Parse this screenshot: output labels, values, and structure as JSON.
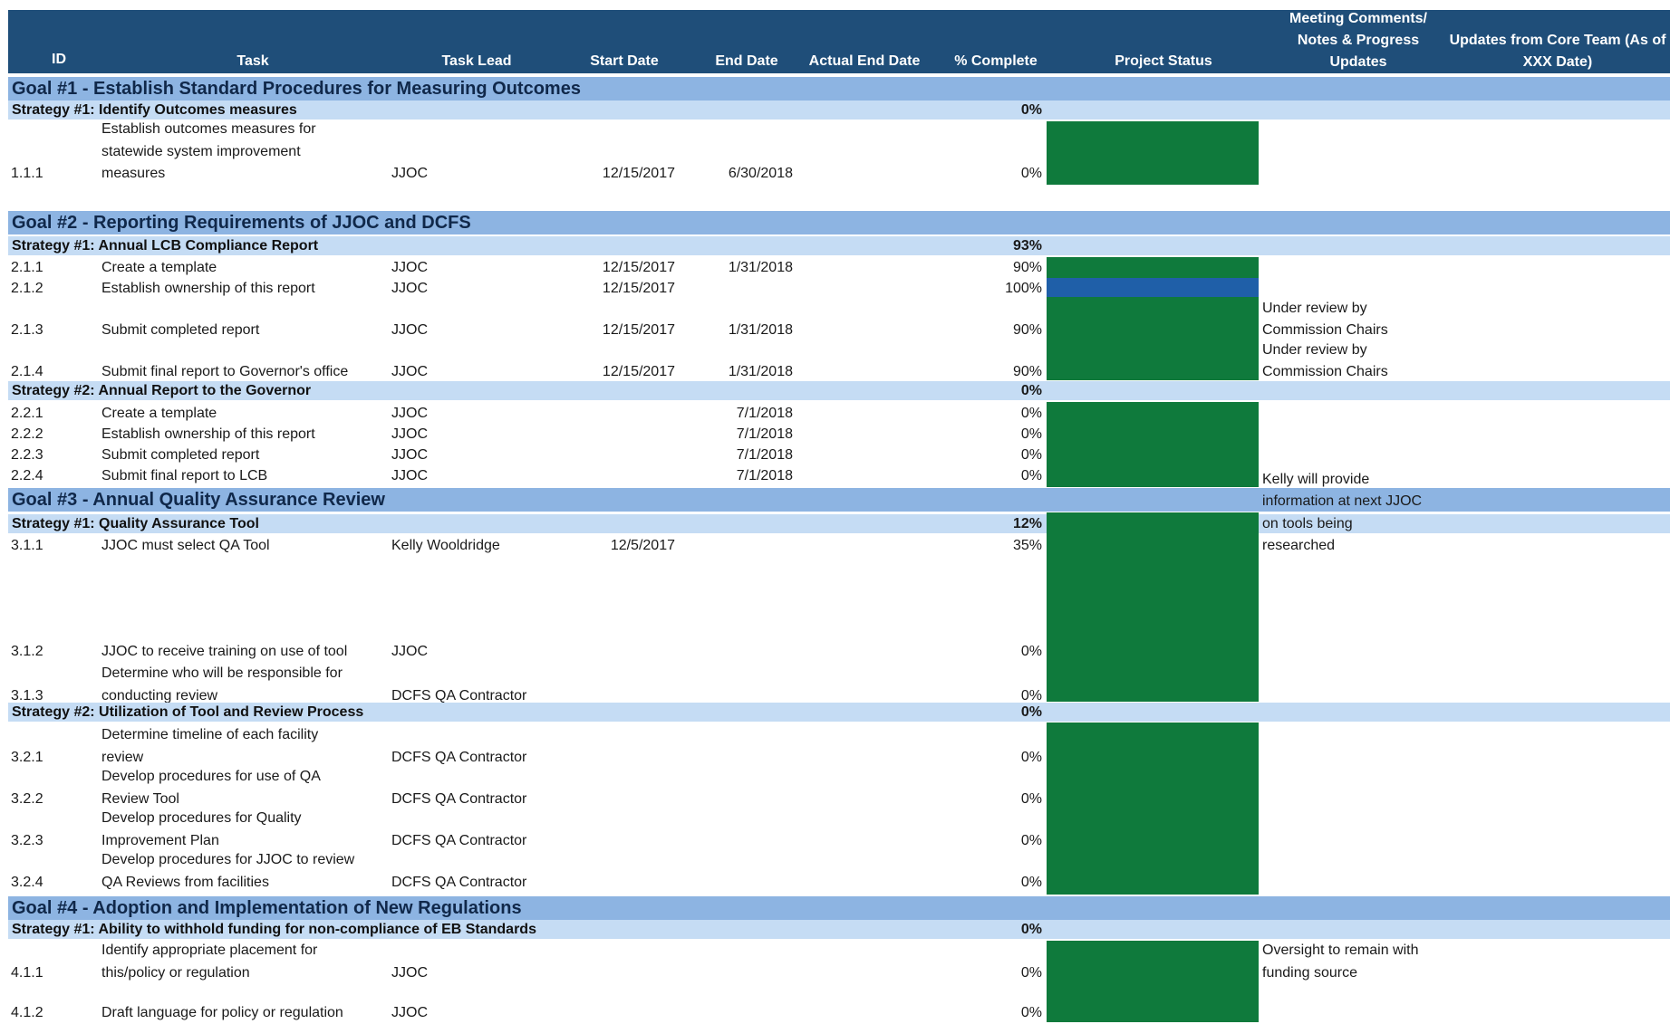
{
  "headers": {
    "id": "ID",
    "task": "Task",
    "task_lead": "Task Lead",
    "start_date": "Start Date",
    "end_date": "End Date",
    "actual_end_date": "Actual End Date",
    "pct_complete": "% Complete",
    "project_status": "Project Status",
    "meeting_comments": [
      "Meeting Comments/",
      "Notes & Progress",
      "Updates"
    ],
    "core_updates": [
      "Updates from Core Team (As of",
      "XXX Date)"
    ]
  },
  "goals": [
    {
      "title": "Goal #1 - Establish Standard Procedures for Measuring Outcomes",
      "strategies": [
        {
          "title": "Strategy #1: Identify Outcomes measures",
          "pct": "0%",
          "tasks": [
            {
              "id": "1.1.1",
              "task": [
                "Establish outcomes measures for",
                "statewide system improvement",
                "measures"
              ],
              "lead": "JJOC",
              "start": "12/15/2017",
              "end": "6/30/2018",
              "pct": "0%",
              "comments": []
            }
          ]
        }
      ]
    },
    {
      "title": "Goal #2 - Reporting Requirements of JJOC and DCFS",
      "strategies": [
        {
          "title": "Strategy #1: Annual LCB Compliance Report",
          "pct": "93%",
          "tasks": [
            {
              "id": "2.1.1",
              "task": [
                "Create a template"
              ],
              "lead": "JJOC",
              "start": "12/15/2017",
              "end": "1/31/2018",
              "pct": "90%",
              "comments": []
            },
            {
              "id": "2.1.2",
              "task": [
                "Establish ownership of this report"
              ],
              "lead": "JJOC",
              "start": "12/15/2017",
              "end": "",
              "pct": "100%",
              "comments": []
            },
            {
              "id": "2.1.3",
              "task": [
                "Submit completed report"
              ],
              "lead": "JJOC",
              "start": "12/15/2017",
              "end": "1/31/2018",
              "pct": "90%",
              "comments": [
                "Under review by",
                "Commission Chairs"
              ]
            },
            {
              "id": "2.1.4",
              "task": [
                "Submit final report to Governor's office"
              ],
              "lead": "JJOC",
              "start": "12/15/2017",
              "end": "1/31/2018",
              "pct": "90%",
              "comments": [
                "Under review by",
                "Commission Chairs"
              ]
            }
          ]
        },
        {
          "title": "Strategy #2: Annual Report to the Governor",
          "pct": "0%",
          "tasks": [
            {
              "id": "2.2.1",
              "task": [
                "Create a template"
              ],
              "lead": "JJOC",
              "start": "",
              "end": "7/1/2018",
              "pct": "0%",
              "comments": []
            },
            {
              "id": "2.2.2",
              "task": [
                "Establish ownership of this report"
              ],
              "lead": "JJOC",
              "start": "",
              "end": "7/1/2018",
              "pct": "0%",
              "comments": []
            },
            {
              "id": "2.2.3",
              "task": [
                "Submit completed report"
              ],
              "lead": "JJOC",
              "start": "",
              "end": "7/1/2018",
              "pct": "0%",
              "comments": []
            },
            {
              "id": "2.2.4",
              "task": [
                "Submit final report to LCB"
              ],
              "lead": "JJOC",
              "start": "",
              "end": "7/1/2018",
              "pct": "0%",
              "comments": []
            }
          ]
        }
      ]
    },
    {
      "title": "Goal #3 - Annual Quality Assurance Review",
      "strategies": [
        {
          "title": "Strategy #1: Quality Assurance Tool",
          "pct": "12%",
          "tasks": [
            {
              "id": "3.1.1",
              "task": [
                "JJOC must select QA Tool"
              ],
              "lead": "Kelly Wooldridge",
              "start": "12/5/2017",
              "end": "",
              "pct": "35%",
              "comments": [
                "Kelly will provide",
                "information at next JJOC",
                "on tools being",
                "researched"
              ]
            },
            {
              "id": "3.1.2",
              "task": [
                "JJOC to receive training on use of tool"
              ],
              "lead": "JJOC",
              "start": "",
              "end": "",
              "pct": "0%",
              "comments": []
            },
            {
              "id": "3.1.3",
              "task": [
                "Determine who will be responsible for",
                "conducting review"
              ],
              "lead": "DCFS QA Contractor",
              "start": "",
              "end": "",
              "pct": "0%",
              "comments": []
            }
          ]
        },
        {
          "title": "Strategy #2: Utilization of Tool and Review Process",
          "pct": "0%",
          "tasks": [
            {
              "id": "3.2.1",
              "task": [
                "Determine timeline of each facility",
                "review"
              ],
              "lead": "DCFS QA Contractor",
              "start": "",
              "end": "",
              "pct": "0%",
              "comments": []
            },
            {
              "id": "3.2.2",
              "task": [
                "Develop procedures for use of QA",
                "Review Tool"
              ],
              "lead": "DCFS QA Contractor",
              "start": "",
              "end": "",
              "pct": "0%",
              "comments": []
            },
            {
              "id": "3.2.3",
              "task": [
                "Develop procedures for Quality",
                "Improvement Plan"
              ],
              "lead": "DCFS QA Contractor",
              "start": "",
              "end": "",
              "pct": "0%",
              "comments": []
            },
            {
              "id": "3.2.4",
              "task": [
                "Develop procedures for JJOC to review",
                "QA Reviews from facilities"
              ],
              "lead": "DCFS QA Contractor",
              "start": "",
              "end": "",
              "pct": "0%",
              "comments": []
            }
          ]
        }
      ]
    },
    {
      "title": "Goal #4 - Adoption and Implementation of New Regulations",
      "strategies": [
        {
          "title": "Strategy #1: Ability to withhold funding for non-compliance of EB Standards",
          "pct": "0%",
          "tasks": [
            {
              "id": "4.1.1",
              "task": [
                "Identify appropriate placement for",
                "this/policy or regulation"
              ],
              "lead": "JJOC",
              "start": "",
              "end": "",
              "pct": "0%",
              "comments": [
                "Oversight to remain with",
                "funding source"
              ]
            },
            {
              "id": "4.1.2",
              "task": [
                "Draft language for policy or regulation"
              ],
              "lead": "JJOC",
              "start": "",
              "end": "",
              "pct": "0%",
              "comments": []
            }
          ]
        }
      ]
    }
  ],
  "colors": {
    "header": "#1f4e79",
    "goal_band": "#8db4e2",
    "strategy_band": "#c5dcf4",
    "status_green": "#0f7a3c",
    "status_blue": "#1f5fa8"
  }
}
